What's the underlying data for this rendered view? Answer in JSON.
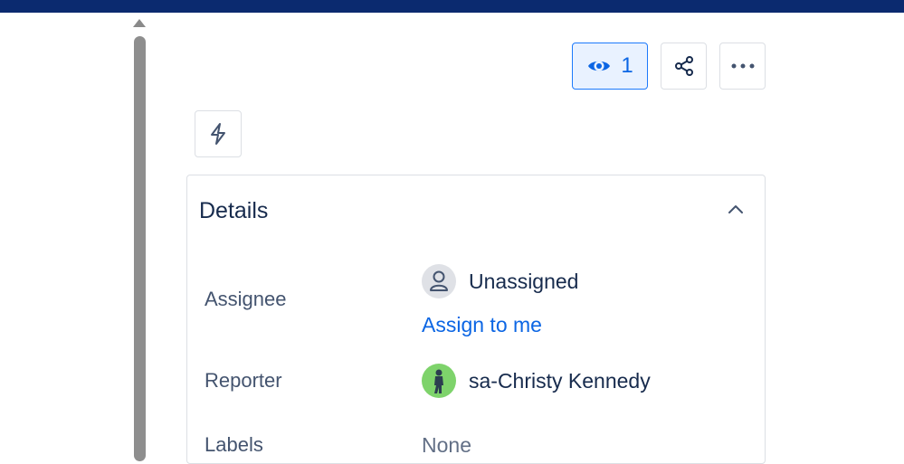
{
  "toolbar": {
    "watch_count": "1"
  },
  "details": {
    "title": "Details",
    "fields": {
      "assignee": {
        "label": "Assignee",
        "value": "Unassigned",
        "action": "Assign to me"
      },
      "reporter": {
        "label": "Reporter",
        "value": "sa-Christy Kennedy"
      },
      "labels": {
        "label": "Labels",
        "value": "None"
      }
    }
  },
  "colors": {
    "topbar": "#0b2a6f",
    "accent": "#0c66e4",
    "watch_bg": "#e9f2ff"
  }
}
